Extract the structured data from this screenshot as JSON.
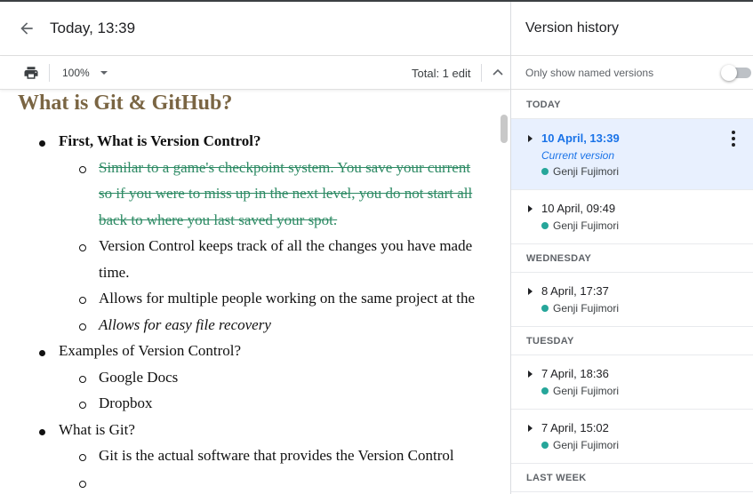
{
  "editor": {
    "title": "Today, 13:39",
    "zoom": "100%",
    "total_edits": "Total: 1 edit"
  },
  "document": {
    "heading": "What is Git & GitHub?",
    "lines": [
      {
        "text": "First, What is Version Control?",
        "style": "bold",
        "level": 1
      },
      {
        "text": "Similar to a game's checkpoint system. You save your current",
        "style": "strike",
        "level": 2
      },
      {
        "text": "so if you were to miss up in the next level, you do not start all",
        "style": "strike",
        "level": 0
      },
      {
        "text": "back to where you last saved your spot.",
        "style": "strike",
        "level": 0
      },
      {
        "text": "Version Control keeps track of all the changes you have made",
        "style": "normal",
        "level": 2
      },
      {
        "text": "time.",
        "style": "normal",
        "level": 0
      },
      {
        "text": "Allows for multiple people working on the same project at the",
        "style": "normal",
        "level": 2
      },
      {
        "text": "Allows for easy file recovery",
        "style": "italic",
        "level": 2
      },
      {
        "text": "Examples of Version Control?",
        "style": "normal",
        "level": 1
      },
      {
        "text": "Google Docs",
        "style": "normal",
        "level": 2
      },
      {
        "text": "Dropbox",
        "style": "normal",
        "level": 2
      },
      {
        "text": "What is Git?",
        "style": "normal",
        "level": 1
      },
      {
        "text": "Git is the actual software that provides the Version Control",
        "style": "normal",
        "level": 2
      },
      {
        "text": "",
        "style": "normal",
        "level": 2
      }
    ]
  },
  "history": {
    "title": "Version history",
    "named_only_label": "Only show named versions",
    "named_only_on": false,
    "sections": [
      {
        "label": "TODAY",
        "versions": [
          {
            "date": "10 April, 13:39",
            "current_label": "Current version",
            "author": "Genji Fujimori",
            "selected": true
          },
          {
            "date": "10 April, 09:49",
            "author": "Genji Fujimori",
            "selected": false
          }
        ]
      },
      {
        "label": "WEDNESDAY",
        "versions": [
          {
            "date": "8 April, 17:37",
            "author": "Genji Fujimori",
            "selected": false
          }
        ]
      },
      {
        "label": "TUESDAY",
        "versions": [
          {
            "date": "7 April, 18:36",
            "author": "Genji Fujimori",
            "selected": false
          },
          {
            "date": "7 April, 15:02",
            "author": "Genji Fujimori",
            "selected": false
          }
        ]
      },
      {
        "label": "LAST WEEK",
        "versions": []
      }
    ],
    "author_color": "#26a69a"
  },
  "colors": {
    "heading": "#7a6543",
    "strikethrough_text": "#2d8a64",
    "accent": "#1a73e8",
    "selected_row": "#e8f0fe"
  },
  "icons": {
    "back": "arrow-left-icon",
    "print": "printer-icon",
    "zoom_caret": "caret-down-icon",
    "collapse": "chevron-up-icon",
    "expand": "triangle-right-icon",
    "more": "more-vert-icon"
  }
}
